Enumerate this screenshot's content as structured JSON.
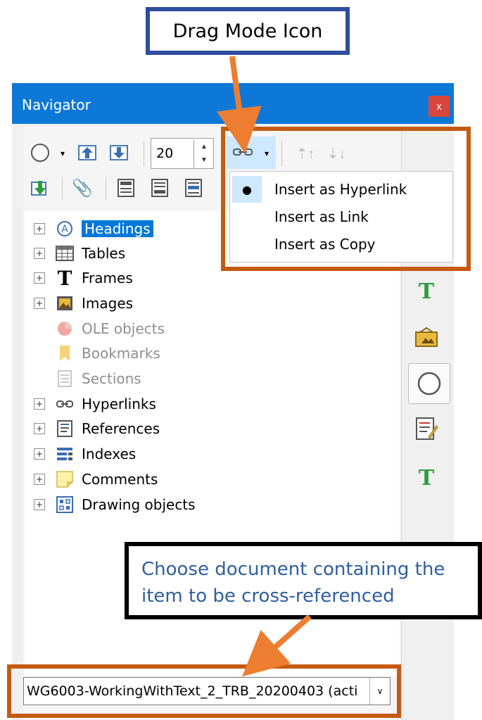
{
  "callouts": {
    "top": "Drag Mode Icon",
    "bottom_line1": "Choose document containing the",
    "bottom_line2": "item to be cross-referenced"
  },
  "window": {
    "title": "Navigator",
    "close_glyph": "x"
  },
  "toolbar": {
    "spin_value": "20",
    "icons": [
      "navigation-compass-icon",
      "promote-chapter-icon",
      "demote-chapter-icon",
      "drag-mode-icon",
      "promote-level-icon",
      "demote-level-icon",
      "toggle-content-icon",
      "reminder-icon",
      "header-icon",
      "footer-icon",
      "anchor-icon",
      "more-options-icon"
    ]
  },
  "drag_menu": {
    "items": [
      {
        "label": "Insert as Hyperlink",
        "selected": true
      },
      {
        "label": "Insert as Link",
        "selected": false
      },
      {
        "label": "Insert as Copy",
        "selected": false
      }
    ]
  },
  "tree": {
    "items": [
      {
        "label": "Headings",
        "expandable": true,
        "enabled": true,
        "highlighted": true
      },
      {
        "label": "Tables",
        "expandable": true,
        "enabled": true
      },
      {
        "label": "Frames",
        "expandable": true,
        "enabled": true
      },
      {
        "label": "Images",
        "expandable": true,
        "enabled": true
      },
      {
        "label": "OLE objects",
        "expandable": false,
        "enabled": false
      },
      {
        "label": "Bookmarks",
        "expandable": false,
        "enabled": false
      },
      {
        "label": "Sections",
        "expandable": false,
        "enabled": false
      },
      {
        "label": "Hyperlinks",
        "expandable": true,
        "enabled": true
      },
      {
        "label": "References",
        "expandable": true,
        "enabled": true
      },
      {
        "label": "Indexes",
        "expandable": true,
        "enabled": true
      },
      {
        "label": "Comments",
        "expandable": true,
        "enabled": true
      },
      {
        "label": "Drawing objects",
        "expandable": true,
        "enabled": true
      }
    ]
  },
  "document_combo": {
    "value": "WG6003-WorkingWithText_2_TRB_20200403 (acti"
  },
  "colors": {
    "titlebar": "#0e78d7",
    "highlight": "#0078d7",
    "callout_orange": "#c55a11",
    "callout_blue": "#2e4d9e",
    "bottom_text": "#2f5f9f"
  }
}
